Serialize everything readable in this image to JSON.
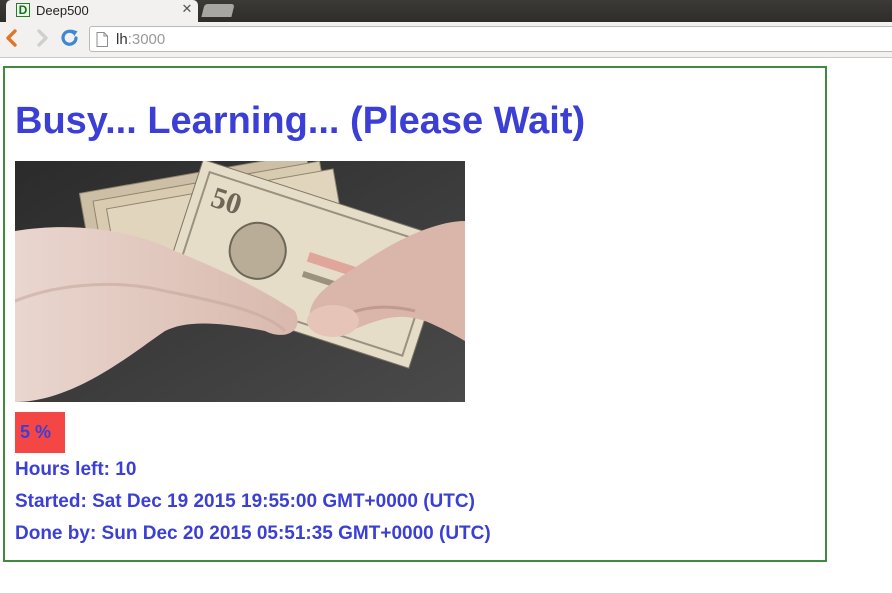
{
  "browser": {
    "tab": {
      "title": "Deep500",
      "favicon_letter": "D",
      "close_glyph": "✕"
    },
    "address_bar": {
      "host": "lh",
      "port": ":3000"
    }
  },
  "page": {
    "heading": "Busy... Learning... (Please Wait)",
    "image_icon": "hands-counting-dollar-bills",
    "progress": {
      "percent": 5,
      "label": "5 %",
      "color": "#f54646"
    },
    "hours_left": "Hours left: 10",
    "started": "Started: Sat Dec 19 2015 19:55:00 GMT+0000 (UTC)",
    "done_by": "Done by: Sun Dec 20 2015 05:51:35 GMT+0000 (UTC)"
  },
  "colors": {
    "text": "#3b3fd6",
    "border": "#3f8a3f"
  }
}
